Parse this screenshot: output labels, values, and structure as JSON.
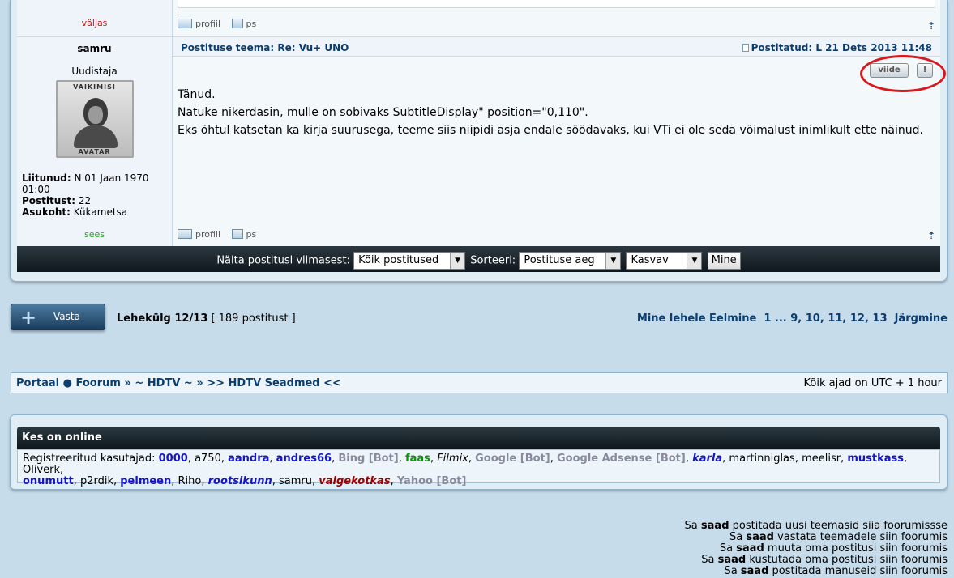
{
  "prev_post": {
    "status": "väljas",
    "footer": {
      "profile": "profiil",
      "pm": "ps"
    }
  },
  "post": {
    "author": "samru",
    "rank": "Uudistaja",
    "avatar_top": "VAIKIMISI",
    "avatar_bottom": "AVATAR",
    "joined_label": "Liitunud:",
    "joined_value": "N 01 Jaan 1970 01:00",
    "posts_label": "Postitust:",
    "posts_value": "22",
    "location_label": "Asukoht:",
    "location_value": "Kükametsa",
    "status": "sees",
    "subject_label": "Postituse teema:",
    "subject": "Re: Vu+ UNO",
    "posted_label": "Postitatud:",
    "posted": "L 21 Dets 2013 11:48",
    "quote_btn": "viide",
    "report_btn": "!",
    "body": [
      "Tänud.",
      "Natuke nikerdasin, mulle on sobivaks SubtitleDisplay\" position=\"0,110\".",
      "Eks õhtul katsetan ka kirja suurusega, teeme siis niipidi asja endale söödavaks, kui VTi ei ole seda võimalust inimlikult ette näinud."
    ],
    "footer": {
      "profile": "profiil",
      "pm": "ps"
    }
  },
  "sort": {
    "show_label": "Näita postitusi viimasest:",
    "show_value": "Kõik postitused",
    "sort_label": "Sorteeri:",
    "sort_value": "Postituse aeg",
    "order_value": "Kasvav",
    "go": "Mine"
  },
  "reply": {
    "label": "Vasta"
  },
  "page_info": {
    "label": "Lehekülg 12/13",
    "count": "[ 189 postitust ]"
  },
  "pagination": {
    "label": "Mine lehele",
    "prev": "Eelmine",
    "pages": "1 ... 9, 10, 11, 12, 13",
    "next": "Järgmine"
  },
  "breadcrumb": {
    "text": "Portaal ● Foorum » ~ HDTV ~ » >> HDTV Seadmed <<"
  },
  "timezone": "Kõik ajad on UTC + 1 hour",
  "online": {
    "title": "Kes on online",
    "registered_label": "Registreeritud kasutajad:"
  },
  "permissions": [
    {
      "pre": "Sa",
      "bold": "saad",
      "post": "postitada uusi teemasid siia foorumissse"
    },
    {
      "pre": "Sa",
      "bold": "saad",
      "post": "vastata teemadele siin foorumis"
    },
    {
      "pre": "Sa",
      "bold": "saad",
      "post": "muuta oma postitusi siin foorumis"
    },
    {
      "pre": "Sa",
      "bold": "saad",
      "post": "kustutada oma postitusi siin foorumis"
    },
    {
      "pre": "Sa",
      "bold": "saad",
      "post": "postitada manuseid siin foorumis"
    }
  ],
  "colors": {
    "accent": "#0b3d6e",
    "online": "#2aa02a",
    "offline": "#c01818",
    "highlight": "#d9181d"
  }
}
